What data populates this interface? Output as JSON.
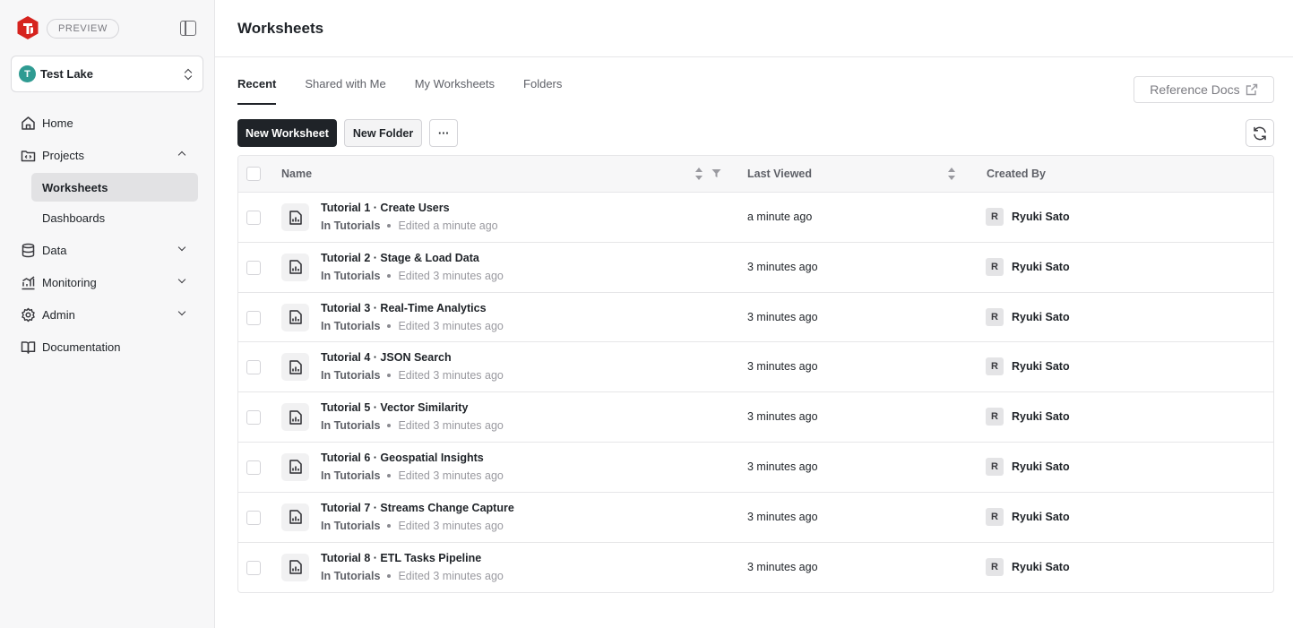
{
  "brand": {
    "preview_label": "PREVIEW",
    "logo_color": "#d6231e"
  },
  "lake": {
    "initial": "T",
    "name": "Test Lake",
    "avatar_color": "#2f9b92"
  },
  "sidebar": {
    "items": [
      {
        "label": "Home",
        "icon": "home-icon"
      },
      {
        "label": "Projects",
        "icon": "projects-icon",
        "expanded": true
      },
      {
        "label": "Data",
        "icon": "database-icon"
      },
      {
        "label": "Monitoring",
        "icon": "monitoring-icon"
      },
      {
        "label": "Admin",
        "icon": "gear-icon"
      },
      {
        "label": "Documentation",
        "icon": "book-icon"
      }
    ],
    "project_sub_items": [
      {
        "label": "Worksheets",
        "active": true
      },
      {
        "label": "Dashboards",
        "active": false
      }
    ]
  },
  "header": {
    "title": "Worksheets"
  },
  "tabs": [
    {
      "label": "Recent",
      "active": true
    },
    {
      "label": "Shared with Me",
      "active": false
    },
    {
      "label": "My Worksheets",
      "active": false
    },
    {
      "label": "Folders",
      "active": false
    }
  ],
  "reference_docs_label": "Reference Docs",
  "toolbar": {
    "new_worksheet_label": "New Worksheet",
    "new_folder_label": "New Folder",
    "more_label": "···"
  },
  "table": {
    "columns": {
      "name": "Name",
      "last_viewed": "Last Viewed",
      "created_by": "Created By"
    },
    "rows": [
      {
        "title": "Tutorial 1 · Create Users",
        "folder": "In Tutorials",
        "edited": "Edited a minute ago",
        "last_viewed": "a minute ago",
        "creator_initial": "R",
        "creator": "Ryuki Sato"
      },
      {
        "title": "Tutorial 2 · Stage & Load Data",
        "folder": "In Tutorials",
        "edited": "Edited 3 minutes ago",
        "last_viewed": "3 minutes ago",
        "creator_initial": "R",
        "creator": "Ryuki Sato"
      },
      {
        "title": "Tutorial 3 · Real-Time Analytics",
        "folder": "In Tutorials",
        "edited": "Edited 3 minutes ago",
        "last_viewed": "3 minutes ago",
        "creator_initial": "R",
        "creator": "Ryuki Sato"
      },
      {
        "title": "Tutorial 4 · JSON Search",
        "folder": "In Tutorials",
        "edited": "Edited 3 minutes ago",
        "last_viewed": "3 minutes ago",
        "creator_initial": "R",
        "creator": "Ryuki Sato"
      },
      {
        "title": "Tutorial 5 · Vector Similarity",
        "folder": "In Tutorials",
        "edited": "Edited 3 minutes ago",
        "last_viewed": "3 minutes ago",
        "creator_initial": "R",
        "creator": "Ryuki Sato"
      },
      {
        "title": "Tutorial 6 · Geospatial Insights",
        "folder": "In Tutorials",
        "edited": "Edited 3 minutes ago",
        "last_viewed": "3 minutes ago",
        "creator_initial": "R",
        "creator": "Ryuki Sato"
      },
      {
        "title": "Tutorial 7 · Streams Change Capture",
        "folder": "In Tutorials",
        "edited": "Edited 3 minutes ago",
        "last_viewed": "3 minutes ago",
        "creator_initial": "R",
        "creator": "Ryuki Sato"
      },
      {
        "title": "Tutorial 8 · ETL Tasks Pipeline",
        "folder": "In Tutorials",
        "edited": "Edited 3 minutes ago",
        "last_viewed": "3 minutes ago",
        "creator_initial": "R",
        "creator": "Ryuki Sato"
      }
    ]
  }
}
